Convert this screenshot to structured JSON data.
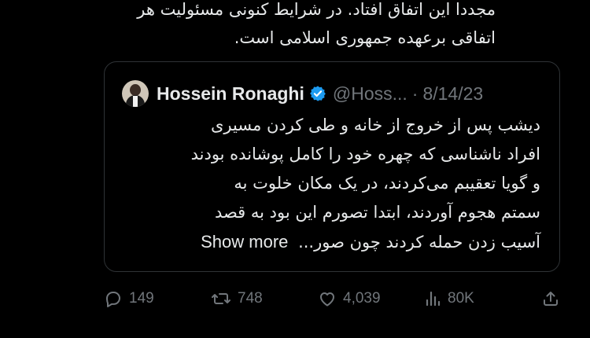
{
  "tweet": {
    "lines": [
      "مجددا این اتفاق افتاد. در شرایط کنونی مسئولیت هر",
      "اتفاقی برعهده جمهوری اسلامی است."
    ]
  },
  "quote": {
    "author_name": "Hossein Ronaghi",
    "handle": "@Hoss...",
    "separator": "·",
    "date": "8/14/23",
    "lines": [
      "دیشب پس از خروج از خانه و طی کردن مسیری",
      "افراد ناشناسی که چهره خود را کامل پوشانده بودند",
      "و گویا تعقیبم می‌کردند، در یک مکان خلوت به",
      "سمتم هجوم آوردند، ابتدا تصورم این بود به قصد",
      "آسیب زدن حمله کردند چون صور..."
    ],
    "show_more": "Show more"
  },
  "actions": {
    "replies": "149",
    "retweets": "748",
    "likes": "4,039",
    "views": "80K"
  },
  "colors": {
    "background": "#000000",
    "text": "#e7e9ea",
    "muted": "#71767b",
    "border": "#2f3336",
    "verified": "#1d9bf0"
  },
  "icons": [
    "reply-icon",
    "retweet-icon",
    "like-icon",
    "views-icon",
    "share-icon",
    "verified-badge-icon"
  ]
}
